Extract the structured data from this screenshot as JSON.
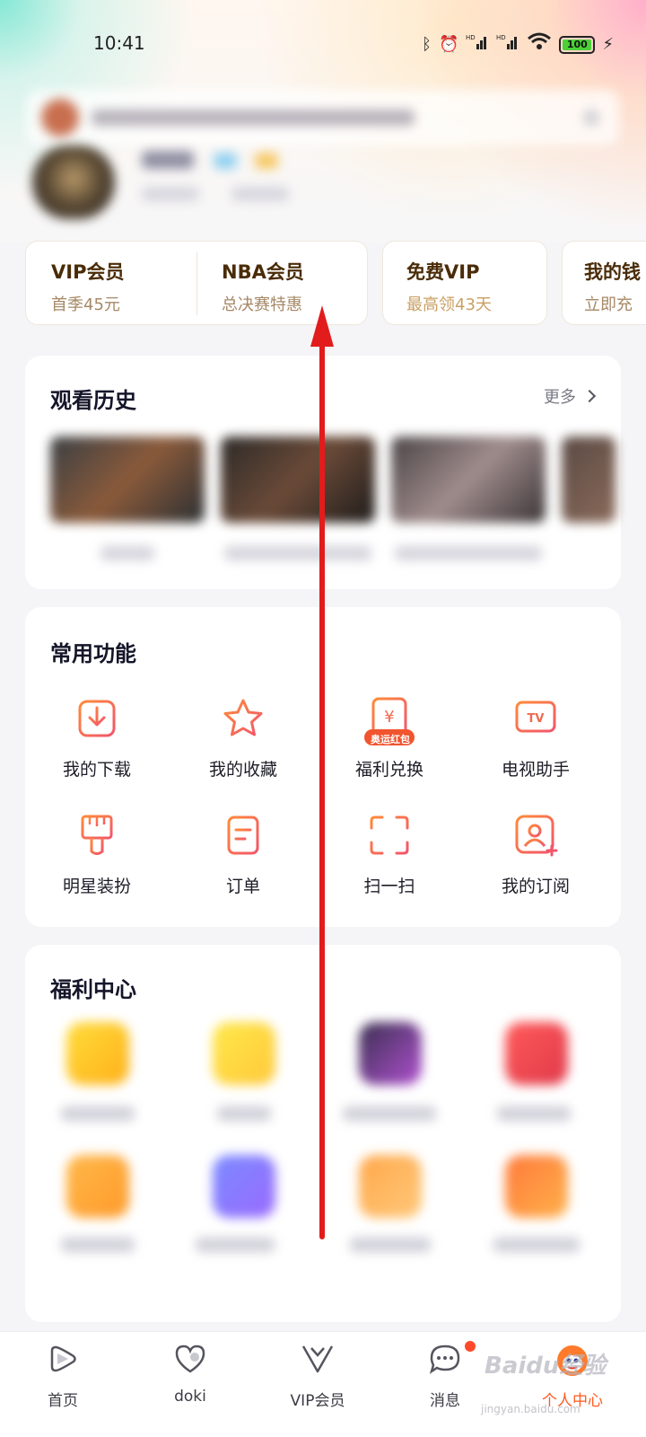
{
  "status_bar": {
    "time": "10:41",
    "battery": "100"
  },
  "vip_cards": [
    {
      "title": "VIP会员",
      "sub": "首季45元"
    },
    {
      "title": "NBA会员",
      "sub": "总决赛特惠"
    },
    {
      "title": "免费VIP",
      "sub": "最高领43天"
    },
    {
      "title": "我的钱",
      "sub": "立即充"
    }
  ],
  "history": {
    "title": "观看历史",
    "more": "更多"
  },
  "functions": {
    "title": "常用功能",
    "items": [
      {
        "label": "我的下载",
        "icon": "download-icon"
      },
      {
        "label": "我的收藏",
        "icon": "star-icon"
      },
      {
        "label": "福利兑换",
        "icon": "yen-coupon-icon",
        "badge": "奥运红包"
      },
      {
        "label": "电视助手",
        "icon": "tv-icon"
      },
      {
        "label": "明星装扮",
        "icon": "brush-icon"
      },
      {
        "label": "订单",
        "icon": "order-icon"
      },
      {
        "label": "扫一扫",
        "icon": "scan-icon"
      },
      {
        "label": "我的订阅",
        "icon": "subscribe-icon"
      }
    ]
  },
  "welfare": {
    "title": "福利中心"
  },
  "bottom_nav": [
    {
      "label": "首页",
      "icon": "home-play-icon"
    },
    {
      "label": "doki",
      "icon": "heart-icon"
    },
    {
      "label": "VIP会员",
      "icon": "vip-crown-icon"
    },
    {
      "label": "消息",
      "icon": "message-icon"
    },
    {
      "label": "个人中心",
      "icon": "mascot-icon"
    }
  ],
  "watermark": {
    "text": "Baidu经验",
    "sub": "jingyan.baidu.com"
  },
  "colors": {
    "accent": "#ff5a1f",
    "icon_gradient_start": "#ff7a3a",
    "icon_gradient_end": "#f2556b",
    "arrow": "#e21c1c",
    "vip_text": "#4a2c08"
  }
}
